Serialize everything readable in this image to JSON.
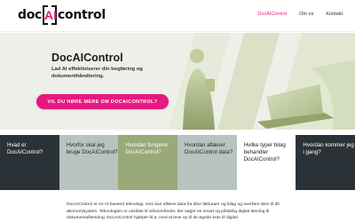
{
  "header": {
    "logo": {
      "prefix": "doc",
      "highlight": "AI",
      "suffix": "control"
    },
    "nav": [
      {
        "label": "DocAIControl",
        "active": true
      },
      {
        "label": "Om os",
        "active": false
      },
      {
        "label": "Kontakt",
        "active": false
      }
    ]
  },
  "hero": {
    "title": "DocAIControl",
    "subtitle": "Lad AI effektiviserer din bogføring og dokumenthåndtering.",
    "cta_label": "VIL DU HØRE MERE OM DOCAICONTROL?"
  },
  "tiles": [
    {
      "label": "Hvad er DocAIControl?",
      "style": "dark"
    },
    {
      "label": "Hvorfor skal jeg bruge DocAIControl?",
      "style": "sage"
    },
    {
      "label": "Hvordan fungerer DocAIControl?",
      "style": "olive"
    },
    {
      "label": "Hvordan aflæser DocAIControl data?",
      "style": "sage"
    },
    {
      "label": "Hvilke typer bilag behandler DocAIControl?",
      "style": "white"
    },
    {
      "label": "Hvordan kommer jeg i gang?",
      "style": "dark"
    }
  ],
  "body": {
    "paragraph": "DocAIControl er en AI-baseret teknologi, som kan aflæse data fra dine fakturaer og bilag og overføre dem til dit økonomisystem. Teknologien er udviklet til virksomheder, der søger en smart og pålidelig digital løsning til dokumentaflæsning. DocAIControl hjælper bl.a. med at leve op til de øgede krav til digital"
  },
  "colors": {
    "accent": "#e5197f",
    "dark_tile": "#2b3237",
    "sage_tile": "#b8c3c0",
    "olive_tile": "#9aa978",
    "hero_bg": "#efefea"
  }
}
